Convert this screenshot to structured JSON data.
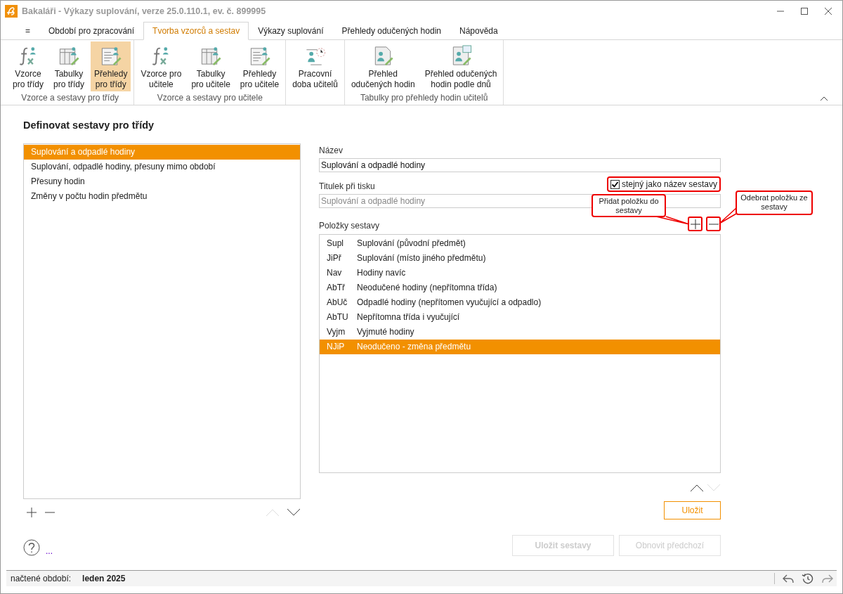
{
  "window": {
    "title": "Bakaláři - Výkazy suplování, verze 25.0.110.1, ev. č. 899995"
  },
  "tabs": [
    {
      "label": "=",
      "selected": false
    },
    {
      "label": "Období pro zpracování",
      "selected": false
    },
    {
      "label": "Tvorba vzorců a sestav",
      "selected": true
    },
    {
      "label": "Výkazy suplování",
      "selected": false
    },
    {
      "label": "Přehledy odučených hodin",
      "selected": false
    },
    {
      "label": "Nápověda",
      "selected": false
    }
  ],
  "ribbon": {
    "groups": [
      {
        "label": "Vzorce a sestavy pro třídy",
        "buttons": [
          {
            "kind": "formula",
            "lines": [
              "Vzorce",
              "pro třídy"
            ],
            "selected": false
          },
          {
            "kind": "table",
            "lines": [
              "Tabulky",
              "pro třídy"
            ],
            "selected": false
          },
          {
            "kind": "report",
            "lines": [
              "Přehledy",
              "pro třídy"
            ],
            "selected": true
          }
        ]
      },
      {
        "label": "Vzorce a sestavy pro učitele",
        "buttons": [
          {
            "kind": "formula",
            "lines": [
              "Vzorce pro",
              "učitele"
            ],
            "selected": false
          },
          {
            "kind": "table",
            "lines": [
              "Tabulky",
              "pro učitele"
            ],
            "selected": false
          },
          {
            "kind": "report",
            "lines": [
              "Přehledy",
              "pro učitele"
            ],
            "selected": false
          }
        ]
      },
      {
        "buttons": [
          {
            "kind": "worktime",
            "lines": [
              "Pracovní",
              "doba učitelů"
            ],
            "selected": false
          }
        ]
      },
      {
        "label": "Tabulky pro přehledy hodin učitelů",
        "buttons": [
          {
            "kind": "doc",
            "lines": [
              "Přehled",
              "odučených hodin"
            ],
            "selected": false
          },
          {
            "kind": "doccal",
            "lines": [
              "Přehled odučených",
              "hodin podle dnů"
            ],
            "selected": false
          }
        ]
      }
    ]
  },
  "page_title": "Definovat sestavy pro třídy",
  "report_list": {
    "items": [
      {
        "label": "Suplování a odpadlé hodiny",
        "selected": true
      },
      {
        "label": "Suplování, odpadlé hodiny, přesuny mimo období",
        "selected": false
      },
      {
        "label": "Přesuny hodin",
        "selected": false
      },
      {
        "label": "Změny v počtu hodin předmětu",
        "selected": false
      }
    ],
    "move_up": {
      "disabled": true
    },
    "move_down": {
      "disabled": false
    }
  },
  "editor": {
    "name_label": "Název",
    "name_value": "Suplování a odpadlé hodiny",
    "print_title_label": "Titulek při tisku",
    "same_as_name": {
      "label": "stejný jako název sestavy",
      "checked": true
    },
    "print_title": {
      "value": "Suplování a odpadlé hodiny",
      "disabled": true
    },
    "items_label": "Položky sestavy",
    "callouts": [
      {
        "text": "Přidat položku do sestavy"
      },
      {
        "text": "Odebrat položku ze sestavy"
      }
    ],
    "items": [
      {
        "code": "Supl",
        "label": "Suplování (původní předmět)",
        "selected": false
      },
      {
        "code": "JiPř",
        "label": "Suplování (místo jiného předmětu)",
        "selected": false
      },
      {
        "code": "Nav",
        "label": "Hodiny navíc",
        "selected": false
      },
      {
        "code": "AbTř",
        "label": "Neodučené hodiny (nepřítomna třída)",
        "selected": false
      },
      {
        "code": "AbUč",
        "label": "Odpadlé hodiny (nepřítomen vyučující a odpadlo)",
        "selected": false
      },
      {
        "code": "AbTU",
        "label": "Nepřítomna třída i vyučující",
        "selected": false
      },
      {
        "code": "Vyjm",
        "label": "Vyjmuté hodiny",
        "selected": false
      },
      {
        "code": "NJiP",
        "label": "Neodučeno - změna předmětu",
        "selected": true
      }
    ],
    "move_up": {
      "disabled": false
    },
    "move_down": {
      "disabled": true
    },
    "save_label": "Uložit"
  },
  "bottom_buttons": [
    {
      "label": "Uložit sestavy",
      "disabled": true
    },
    {
      "label": "Obnovit předchozí",
      "disabled": true
    }
  ],
  "more_link": "...",
  "status_bar": {
    "label": "načtené období:",
    "value": "leden 2025"
  }
}
